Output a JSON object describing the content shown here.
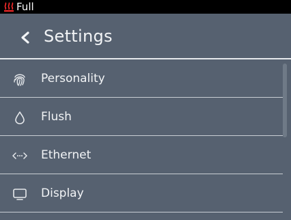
{
  "status": {
    "icon": "heater-icon",
    "text": "Full",
    "icon_color": "#ff2a2a"
  },
  "header": {
    "title": "Settings",
    "back_icon": "chevron-left-icon"
  },
  "menu": {
    "items": [
      {
        "label": "Personality",
        "icon": "fingerprint-icon"
      },
      {
        "label": "Flush",
        "icon": "water-drop-icon"
      },
      {
        "label": "Ethernet",
        "icon": "ethernet-icon"
      },
      {
        "label": "Display",
        "icon": "monitor-icon"
      }
    ]
  },
  "colors": {
    "background": "#566170",
    "statusbar": "#000000",
    "text": "#f2f4f6",
    "divider": "#c9ced4"
  }
}
